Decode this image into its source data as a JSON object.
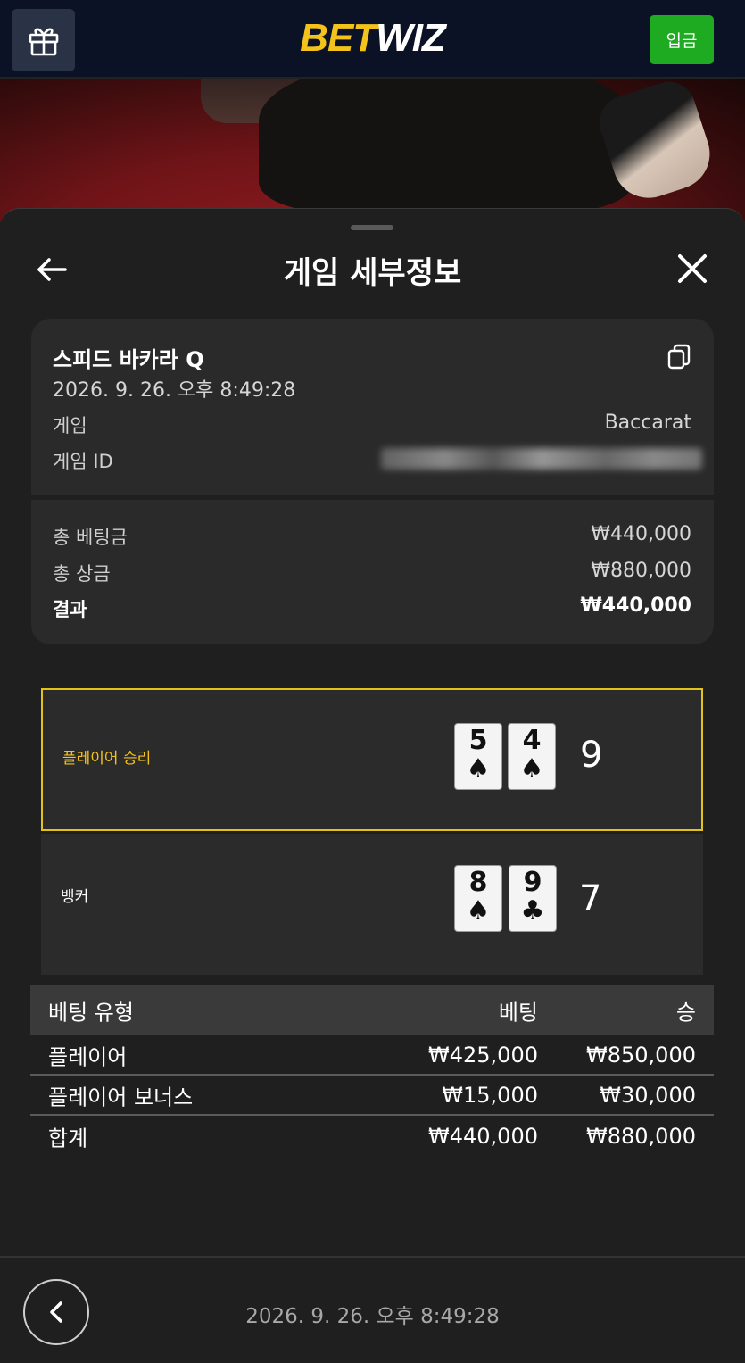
{
  "header": {
    "logo_bet": "BET",
    "logo_wiz": "WIZ",
    "deposit_label": "입금",
    "gift_icon": "gift-icon"
  },
  "sheet": {
    "title": "게임 세부정보",
    "back_icon": "arrow-left-icon",
    "close_icon": "close-icon"
  },
  "game": {
    "name": "스피드 바카라 Q",
    "datetime": "2026. 9. 26. 오후 8:49:28",
    "copy_icon": "copy-icon",
    "game_label": "게임",
    "game_value": "Baccarat",
    "id_label": "게임 ID"
  },
  "summary": {
    "total_bet_label": "총 베팅금",
    "total_bet_value": "₩440,000",
    "total_win_label": "총 상금",
    "total_win_value": "₩880,000",
    "result_label": "결과",
    "result_value": "₩440,000"
  },
  "outcome": {
    "player": {
      "label": "플레이어 승리",
      "cards": [
        {
          "rank": "5",
          "suit": "♠"
        },
        {
          "rank": "4",
          "suit": "♠"
        }
      ],
      "score": "9"
    },
    "banker": {
      "label": "뱅커",
      "cards": [
        {
          "rank": "8",
          "suit": "♠"
        },
        {
          "rank": "9",
          "suit": "♣"
        }
      ],
      "score": "7"
    },
    "win_color": "#e4c21c"
  },
  "bets": {
    "headers": {
      "type": "베팅 유형",
      "bet": "베팅",
      "win": "승"
    },
    "rows": [
      {
        "type": "플레이어",
        "bet": "₩425,000",
        "win": "₩850,000"
      },
      {
        "type": "플레이어 보너스",
        "bet": "₩15,000",
        "win": "₩30,000"
      }
    ],
    "total": {
      "type": "합계",
      "bet": "₩440,000",
      "win": "₩880,000"
    }
  },
  "footer": {
    "datetime": "2026. 9. 26. 오후 8:49:28",
    "back_icon": "chevron-left-icon"
  },
  "colors": {
    "accent": "#f3c21b",
    "deposit": "#1eab22",
    "topbar": "#0c1226"
  }
}
